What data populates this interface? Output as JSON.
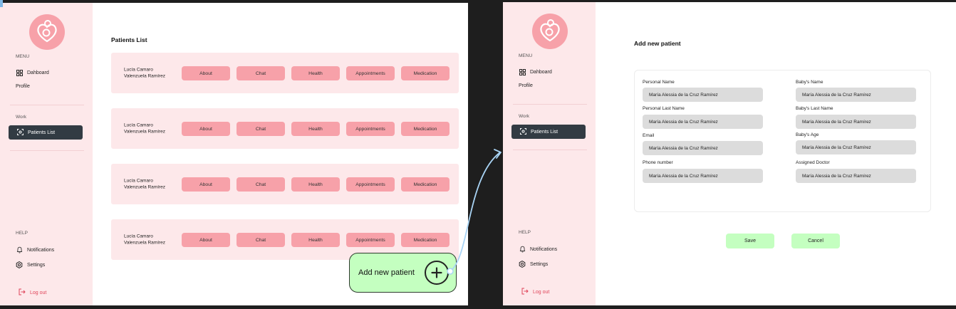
{
  "sidebar": {
    "menu_label": "MENU",
    "dashboard": "Dahboard",
    "profile": "Profile",
    "work_label": "Work",
    "patients_list": "Patients List",
    "help_label": "HELP",
    "notifications": "Notifications",
    "settings": "Settings",
    "logout": "Log out"
  },
  "patients_screen": {
    "title": "Patients List",
    "patients": [
      {
        "name": "Lucía Camaro Valenzuela Ramírez"
      },
      {
        "name": "Lucía Camaro Valenzuela Ramírez"
      },
      {
        "name": "Lucía Camaro Valenzuela Ramírez"
      },
      {
        "name": "Lucía Camaro Valenzuela Ramírez"
      }
    ],
    "buttons": {
      "about": "About",
      "chat": "Chat",
      "health": "Health",
      "appointments": "Appointments",
      "medication": "Medication"
    },
    "add_patient": "Add new patient"
  },
  "add_screen": {
    "title": "Add new patient",
    "fields": {
      "personal_name": {
        "label": "Personal Name",
        "value": "María Alessia de la Cruz Ramírez"
      },
      "personal_last_name": {
        "label": "Personal Last Name",
        "value": "María Alessia de la Cruz Ramírez"
      },
      "email": {
        "label": "Email",
        "value": "María Alessia de la Cruz Ramírez"
      },
      "phone": {
        "label": "Phone number",
        "value": "María Alessia de la Cruz Ramírez"
      },
      "baby_name": {
        "label": "Baby's Name",
        "value": "María Alessia de la Cruz Ramírez"
      },
      "baby_last_name": {
        "label": "Baby's Last Name",
        "value": "María Alessia de la Cruz Ramírez"
      },
      "baby_age": {
        "label": "Baby's Age",
        "value": "María Alessia de la Cruz Ramírez"
      },
      "assigned_doctor": {
        "label": "Assigned Doctor",
        "value": "María Alessia de la Cruz Ramírez"
      }
    },
    "save": "Save",
    "cancel": "Cancel"
  },
  "colors": {
    "sidebar_bg": "#fde8ea",
    "accent_pink": "#f7a1a9",
    "active_nav": "#323b43",
    "action_green": "#c4ffc0",
    "logout_red": "#e0455a",
    "connector_blue": "#a9d4f5"
  },
  "icons": {
    "logo": "mother-baby-heart-logo",
    "dashboard": "grid-icon",
    "patients": "scan-person-icon",
    "notifications": "bell-icon",
    "settings": "gear-icon",
    "logout": "logout-icon",
    "add": "plus-circle-icon"
  }
}
